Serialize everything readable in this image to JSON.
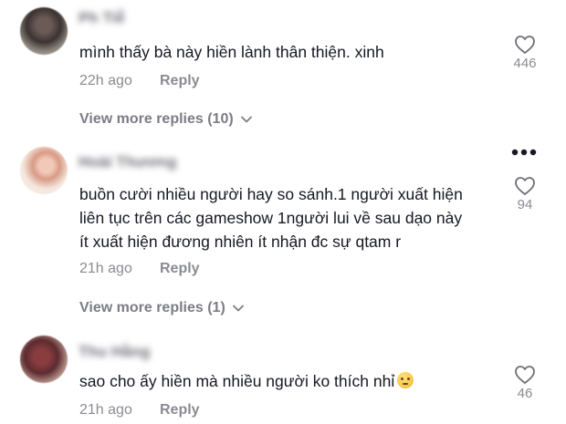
{
  "comments": [
    {
      "username": "Ph Tiễ",
      "text_lines": [
        "mình thấy bà này hiền lành thân thiện. xinh"
      ],
      "time": "22h ago",
      "reply_label": "Reply",
      "likes": "446",
      "view_more": "View more replies (10)"
    },
    {
      "username": "Hoài Thương",
      "text_lines": [
        "buồn cười nhiều người hay so sánh.1 người xuất hiện",
        "liên tục trên các gameshow 1người lui về sau dạo này",
        "ít xuất hiện đương nhiên ít nhận đc sự qtam r"
      ],
      "time": "21h ago",
      "reply_label": "Reply",
      "likes": "94",
      "view_more": "View more replies (1)"
    },
    {
      "username": "Thu Hằng",
      "text_lines": [
        "sao cho ấy hiền mà nhiều người ko thích nhỉ"
      ],
      "time": "21h ago",
      "reply_label": "Reply",
      "likes": "46",
      "emoji": "thinking-face-emoji"
    }
  ],
  "icons": {
    "like": "heart-outline-icon",
    "expand": "chevron-down-icon",
    "more": "more-dots-icon"
  },
  "colors": {
    "text": "#161823",
    "muted": "#8a8b91",
    "username_blurred": "#6f7078"
  }
}
